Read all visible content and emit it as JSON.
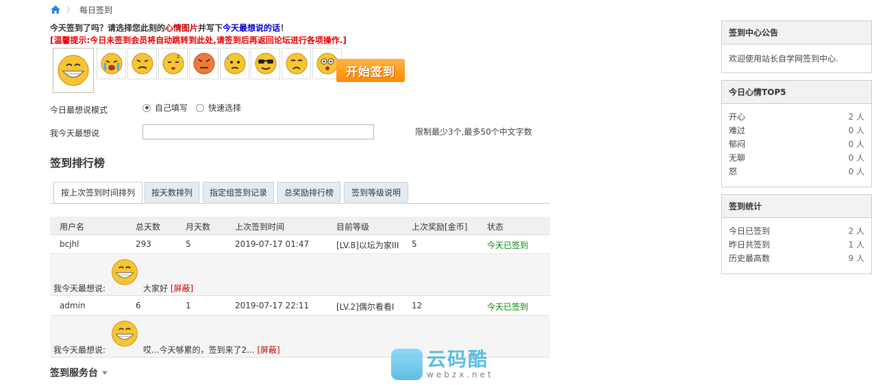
{
  "breadcrumb": {
    "home_icon": "home-icon",
    "current": "每日签到"
  },
  "prompt": {
    "part1": "今天签到了吗？请选择您此刻的",
    "mood_pic": "心情图片",
    "part2": "并写下",
    "today_say": "今天最想说的话",
    "part3": "！",
    "tip": "[温馨提示:今日未签到会员将自动跳转到此处,请签到后再返回论坛进行各项操作.]"
  },
  "moods": [
    "grin",
    "cry",
    "frown",
    "sleepy",
    "angry",
    "sweat",
    "cool",
    "pout",
    "surprised"
  ],
  "start_button": "开始签到",
  "form": {
    "mode_label": "今日最想说模式",
    "option_self": "自己填写",
    "option_quick": "快速选择",
    "say_label": "我今天最想说",
    "say_value": "",
    "hint": "限制最少3个,最多50个中文字数"
  },
  "rank_title": "签到排行榜",
  "tabs": [
    "按上次签到时间排列",
    "按天数排列",
    "指定组签到记录",
    "总奖励排行榜",
    "签到等级说明"
  ],
  "table": {
    "headers": [
      "用户名",
      "总天数",
      "月天数",
      "上次签到时间",
      "目前等级",
      "上次奖励[金币]",
      "状态"
    ],
    "rows": [
      {
        "user": "bcjhl",
        "total": "293",
        "month": "5",
        "time": "2019-07-17 01:47",
        "level": "[LV.8]以坛为家III",
        "reward": "5",
        "status": "今天已签到",
        "say_label": "我今天最想说:",
        "say_text": "大家好",
        "shield": "[屏蔽]"
      },
      {
        "user": "admin",
        "total": "6",
        "month": "1",
        "time": "2019-07-17 22:11",
        "level": "[LV.2]偶尔看看I",
        "reward": "12",
        "status": "今天已签到",
        "say_label": "我今天最想说:",
        "say_text": "哎...今天够累的，签到来了2...",
        "shield": "[屏蔽]"
      }
    ]
  },
  "service": "签到服务台",
  "sidebar": {
    "notice": {
      "title": "签到中心公告",
      "text": "欢迎使用站长自学网签到中心."
    },
    "top5": {
      "title": "今日心情TOP5",
      "items": [
        {
          "k": "开心",
          "v": "2 人"
        },
        {
          "k": "难过",
          "v": "0 人"
        },
        {
          "k": "郁闷",
          "v": "0 人"
        },
        {
          "k": "无聊",
          "v": "0 人"
        },
        {
          "k": "怒",
          "v": "0 人"
        }
      ]
    },
    "stats": {
      "title": "签到统计",
      "items": [
        {
          "k": "今日已签到",
          "v": "2 人"
        },
        {
          "k": "昨日共签到",
          "v": "1 人"
        },
        {
          "k": "历史最高数",
          "v": "9 人"
        }
      ]
    }
  },
  "watermark": {
    "cn": "云码酷",
    "en": "webzx.net"
  }
}
